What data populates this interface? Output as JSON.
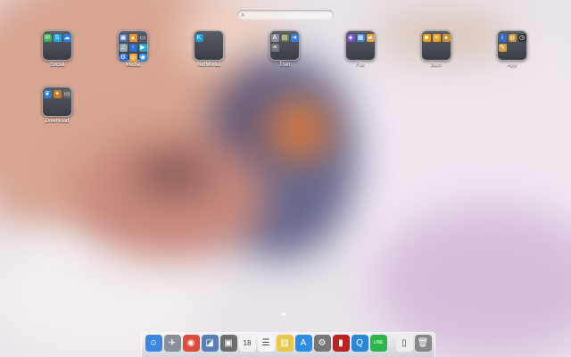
{
  "folders": [
    {
      "label": "Social",
      "apps": [
        {
          "icon": "messages-icon",
          "glyph": "✉",
          "color": "#3bb34a"
        },
        {
          "icon": "skype-icon",
          "glyph": "S",
          "color": "#1fa2e0"
        },
        {
          "icon": "chat-icon",
          "glyph": "☁",
          "color": "#2a7de1"
        }
      ]
    },
    {
      "label": "Media",
      "apps": [
        {
          "icon": "photo-icon",
          "glyph": "▣",
          "color": "#4c72b0"
        },
        {
          "icon": "vlc-icon",
          "glyph": "▲",
          "color": "#f28c28"
        },
        {
          "icon": "tv-icon",
          "glyph": "▭",
          "color": "#556"
        },
        {
          "icon": "music-icon",
          "glyph": "♫",
          "color": "#9aa"
        },
        {
          "icon": "upload-icon",
          "glyph": "↑",
          "color": "#2c6cd6"
        },
        {
          "icon": "player-icon",
          "glyph": "▶",
          "color": "#2aa7c9"
        },
        {
          "icon": "settings-icon",
          "glyph": "⚙",
          "color": "#3a6fd0"
        },
        {
          "icon": "disc-icon",
          "glyph": "◎",
          "color": "#e6a13a"
        },
        {
          "icon": "globe-icon",
          "glyph": "◉",
          "color": "#2c8bd8"
        }
      ]
    },
    {
      "label": "NetMedia",
      "apps": [
        {
          "icon": "k-app-icon",
          "glyph": "K",
          "color": "#1d9bd8"
        }
      ]
    },
    {
      "label": "Tran",
      "apps": [
        {
          "icon": "dictionary-icon",
          "glyph": "A",
          "color": "#8a8f98"
        },
        {
          "icon": "notes-icon",
          "glyph": "▤",
          "color": "#6f7a3a"
        },
        {
          "icon": "arrow-icon",
          "glyph": "➜",
          "color": "#3a7bd5"
        },
        {
          "icon": "lines-icon",
          "glyph": "≡",
          "color": "#777"
        }
      ]
    },
    {
      "label": "File",
      "apps": [
        {
          "icon": "finder-sync-icon",
          "glyph": "◈",
          "color": "#7b4fd0"
        },
        {
          "icon": "archive-icon",
          "glyph": "▦",
          "color": "#3c86d8"
        },
        {
          "icon": "folder-icon",
          "glyph": "▰",
          "color": "#e6a23c"
        }
      ]
    },
    {
      "label": "Bum",
      "apps": [
        {
          "icon": "people-icon",
          "glyph": "☻",
          "color": "#e3a11e"
        },
        {
          "icon": "sun-icon",
          "glyph": "☀",
          "color": "#f0a020"
        },
        {
          "icon": "cookie-icon",
          "glyph": "●",
          "color": "#c89238"
        }
      ]
    },
    {
      "label": "App",
      "apps": [
        {
          "icon": "info-icon",
          "glyph": "i",
          "color": "#2e6bd0"
        },
        {
          "icon": "globe-app-icon",
          "glyph": "◍",
          "color": "#c09040"
        },
        {
          "icon": "clock-icon",
          "glyph": "◷",
          "color": "#333"
        },
        {
          "icon": "tools-icon",
          "glyph": "✎",
          "color": "#d6a43a"
        }
      ]
    },
    {
      "label": "Download",
      "apps": [
        {
          "icon": "bird-icon",
          "glyph": "❦",
          "color": "#2a7fd8"
        },
        {
          "icon": "transmission-icon",
          "glyph": "✦",
          "color": "#c27a2e"
        },
        {
          "icon": "monitor-icon",
          "glyph": "▭",
          "color": "#666"
        }
      ]
    }
  ],
  "dock": [
    {
      "icon": "finder-icon",
      "glyph": "☺",
      "color": "#3b86e0"
    },
    {
      "icon": "launchpad-icon",
      "glyph": "✈",
      "color": "#8a8f98"
    },
    {
      "icon": "chrome-icon",
      "glyph": "◉",
      "color": "#dd4b39"
    },
    {
      "icon": "preview-icon",
      "glyph": "◪",
      "color": "#5a7fb5"
    },
    {
      "icon": "image-capture-icon",
      "glyph": "▣",
      "color": "#6e6e6e"
    },
    {
      "icon": "calendar-icon",
      "glyph": "18",
      "color": "#f2f2f2"
    },
    {
      "icon": "reminders-icon",
      "glyph": "☰",
      "color": "#f5f5f5"
    },
    {
      "icon": "stickies-icon",
      "glyph": "▨",
      "color": "#e8c84a"
    },
    {
      "icon": "app-store-icon",
      "glyph": "A",
      "color": "#2b8de6"
    },
    {
      "icon": "system-preferences-icon",
      "glyph": "⚙",
      "color": "#777"
    },
    {
      "icon": "photo-booth-icon",
      "glyph": "▮",
      "color": "#b22"
    },
    {
      "icon": "quicktime-icon",
      "glyph": "Q",
      "color": "#2b88d9"
    },
    {
      "icon": "line-icon",
      "glyph": "LINE",
      "color": "#2cb34a"
    },
    {
      "icon": "document-icon",
      "glyph": "▯",
      "color": "#eee"
    },
    {
      "icon": "trash-icon",
      "glyph": "🗑",
      "color": "#888"
    }
  ]
}
